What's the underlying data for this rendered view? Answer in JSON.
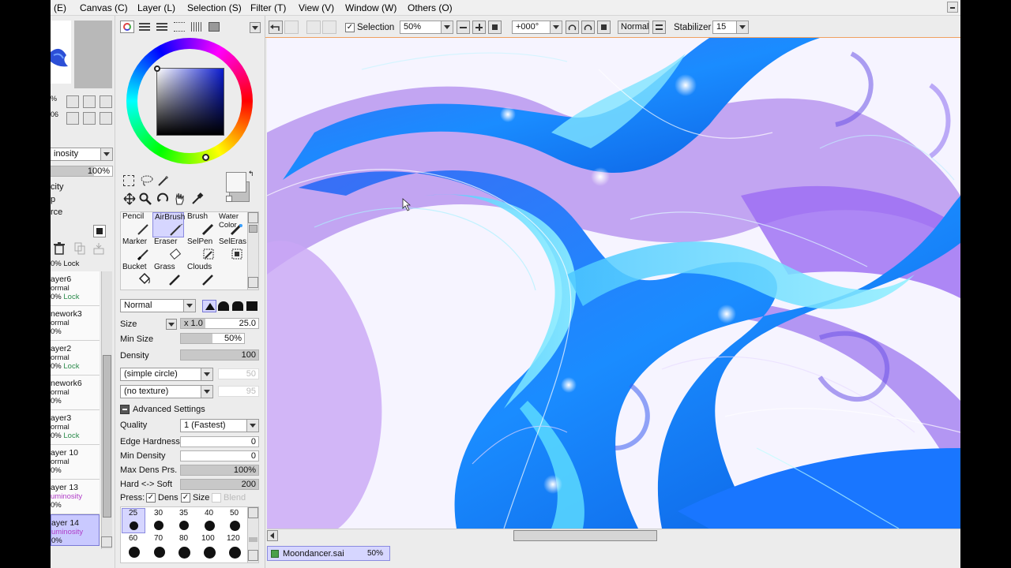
{
  "menu": [
    "(E)",
    "Canvas (C)",
    "Layer (L)",
    "Selection (S)",
    "Filter (T)",
    "View (V)",
    "Window (W)",
    "Others (O)"
  ],
  "toolbar": {
    "selection_label": "Selection",
    "selection_checked": true,
    "zoom": "50%",
    "angle": "+000°",
    "blend": "Normal",
    "stabilizer_label": "Stabilizer",
    "stabilizer_value": "15"
  },
  "left_panel": {
    "zoom_partial": "%",
    "angle_partial": "06",
    "mode_partial": "inosity",
    "opacity": "100%",
    "opt1": "city",
    "opt2": "p",
    "opt3": "rce",
    "top_lock": "0% Lock",
    "layers": [
      {
        "name": "ayer6",
        "mode": "ormal",
        "pct": "0%",
        "lock": "Lock",
        "lum": false
      },
      {
        "name": "nework3",
        "mode": "ormal",
        "pct": "0%",
        "lock": "",
        "lum": false
      },
      {
        "name": "ayer2",
        "mode": "ormal",
        "pct": "0%",
        "lock": "Lock",
        "lum": false
      },
      {
        "name": "nework6",
        "mode": "ormal",
        "pct": "0%",
        "lock": "",
        "lum": false
      },
      {
        "name": "ayer3",
        "mode": "ormal",
        "pct": "0%",
        "lock": "Lock",
        "lum": false
      },
      {
        "name": "ayer 10",
        "mode": "ormal",
        "pct": "0%",
        "lock": "",
        "lum": false
      },
      {
        "name": "ayer 13",
        "mode": "uminosity",
        "pct": "0%",
        "lock": "",
        "lum": true
      },
      {
        "name": "ayer 14",
        "mode": "uminosity",
        "pct": "0%",
        "lock": "",
        "lum": true
      }
    ]
  },
  "tools": [
    {
      "name": "Pencil",
      "icon": "pencil-icon"
    },
    {
      "name": "AirBrush",
      "icon": "airbrush-icon"
    },
    {
      "name": "Brush",
      "icon": "brush-icon"
    },
    {
      "name": "Water Color",
      "icon": "watercolor-icon"
    },
    {
      "name": "Marker",
      "icon": "marker-icon"
    },
    {
      "name": "Eraser",
      "icon": "eraser-icon"
    },
    {
      "name": "SelPen",
      "icon": "selpen-icon"
    },
    {
      "name": "SelEras",
      "icon": "seleras-icon"
    },
    {
      "name": "Bucket",
      "icon": "bucket-icon"
    },
    {
      "name": "Grass",
      "icon": "grass-icon"
    },
    {
      "name": "Clouds",
      "icon": "clouds-icon"
    }
  ],
  "brush": {
    "blend_mode": "Normal",
    "size_label": "Size",
    "size_mult": "x 1.0",
    "size_value": "25.0",
    "min_size_label": "Min Size",
    "min_size_value": "50%",
    "density_label": "Density",
    "density_value": "100",
    "shape": "(simple circle)",
    "shape_value": "50",
    "texture": "(no texture)",
    "texture_value": "95",
    "advanced_label": "Advanced Settings",
    "quality_label": "Quality",
    "quality_value": "1 (Fastest)",
    "edge_label": "Edge Hardness",
    "edge_value": "0",
    "min_density_label": "Min Density",
    "min_density_value": "0",
    "max_dens_label": "Max Dens Prs.",
    "max_dens_value": "100%",
    "hard_soft_label": "Hard <-> Soft",
    "hard_soft_value": "200",
    "press_label": "Press:",
    "dens_label": "Dens",
    "size2_label": "Size",
    "blend_label": "Blend",
    "sizes_row1": [
      "25",
      "30",
      "35",
      "40",
      "50"
    ],
    "sizes_row2": [
      "60",
      "70",
      "80",
      "100",
      "120"
    ]
  },
  "file": {
    "name": "Moondancer.sai",
    "zoom": "50%"
  },
  "colors": {
    "accent": "#f0a060",
    "hair_blue": "#1a8cff",
    "hair_cyan": "#5fe0ff",
    "hair_purple": "#9b6cf2"
  }
}
